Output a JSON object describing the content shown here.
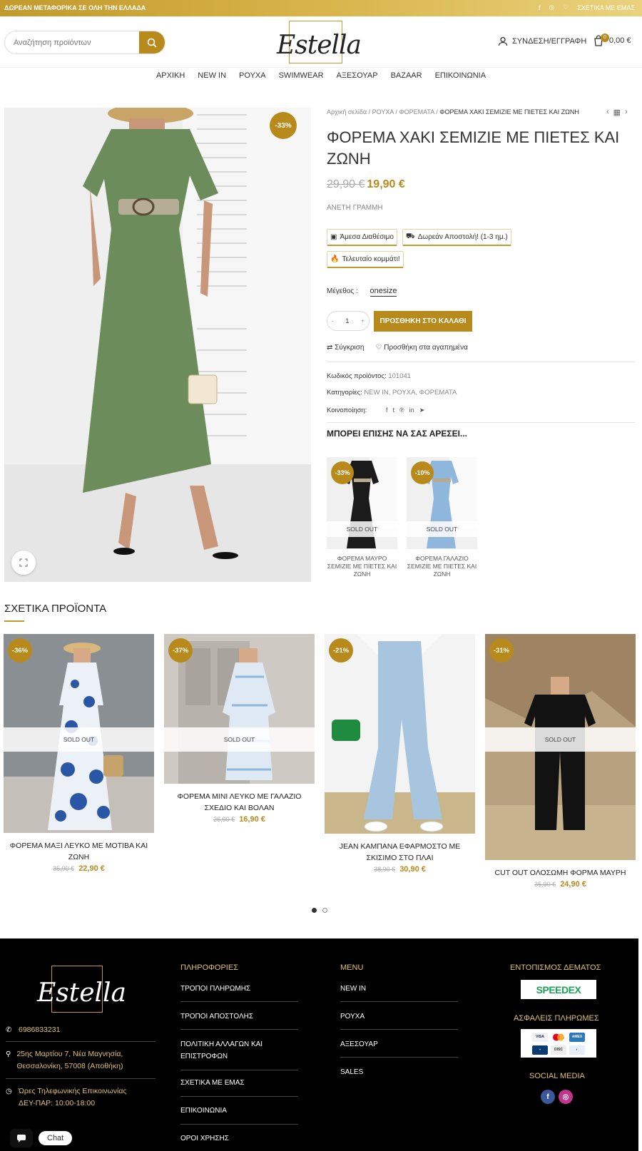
{
  "topbar": {
    "promo": "ΔΩΡΕΑΝ ΜΕΤΑΦΟΡΙΚΑ ΣΕ ΟΛΗ ΤΗΝ ΕΛΛΑΔΑ",
    "about": "ΣΧΕΤΙΚΑ ΜΕ ΕΜΑΣ"
  },
  "header": {
    "search_placeholder": "Αναζήτηση προϊόντων",
    "logo": "Estella",
    "account": "ΣΥΝΔΕΣΗ/ΕΓΓΡΑΦΗ",
    "cart_count": "0",
    "cart_total": "0,00 €"
  },
  "nav": [
    "ΑΡΧΙΚΗ",
    "NEW IN",
    "ΡΟΥΧΑ",
    "SWIMWEAR",
    "ΑΞΕΣΟΥΑΡ",
    "BAZAAR",
    "ΕΠΙΚΟΙΝΩΝΙΑ"
  ],
  "product": {
    "discount": "-33%",
    "breadcrumb": [
      "Αρχική σελίδα",
      "ΡΟΥΧΑ",
      "ΦΟΡΕΜΑΤΑ",
      "ΦΟΡΕΜΑ ΧΑΚΙ ΣΕΜΙΖΙΕ ΜΕ ΠΙΕΤΕΣ ΚΑΙ ΖΩΝΗ"
    ],
    "title": "ΦΟΡΕΜΑ ΧΑΚΙ ΣΕΜΙΖΙΕ ΜΕ ΠΙΕΤΕΣ ΚΑΙ ΖΩΝΗ",
    "old_price": "29,90 €",
    "price": "19,90 €",
    "line": "ΑΝΕΤΗ ΓΡΑΜΜΗ",
    "tags": [
      "Άμεσα Διαθέσιμο",
      "Δωρεάν Αποστολή! (1-3 ημ.)",
      "Τελευταίο κομμάτι!"
    ],
    "size_label": "Μέγεθος :",
    "size_value": "onesize",
    "qty": "1",
    "add_to_cart": "ΠΡΟΣΘΗΚΗ ΣΤΟ ΚΑΛΑΘΙ",
    "compare": "Σύγκριση",
    "wishlist": "Προσθήκη στα αγαπημένα",
    "sku_label": "Κωδικός προϊόντος:",
    "sku": "101041",
    "cat_label": "Κατηγορίες:",
    "cats": "NEW IN, ΡΟΥΧΑ, ΦΟΡΕΜΑΤΑ",
    "share_label": "Κοινοποίηση:"
  },
  "upsell": {
    "title": "ΜΠΟΡΕΙ ΕΠΙΣΗΣ ΝΑ ΣΑΣ ΑΡΕΣΕΙ...",
    "items": [
      {
        "badge": "-33%",
        "status": "SOLD OUT",
        "name": "ΦΟΡΕΜΑ ΜΑΥΡΟ ΣΕΜΙΖΙΕ ΜΕ ΠΙΕΤΕΣ ΚΑΙ ΖΩΝΗ"
      },
      {
        "badge": "-10%",
        "status": "SOLD OUT",
        "name": "ΦΟΡΕΜΑ ΓΑΛΑΖΙΟ ΣΕΜΙΖΙΕ ΜΕ ΠΙΕΤΕΣ ΚΑΙ ΖΩΝΗ"
      }
    ]
  },
  "related": {
    "title": "ΣΧΕΤΙΚΑ ΠΡΟΪΟΝΤΑ",
    "items": [
      {
        "badge": "-36%",
        "status": "SOLD OUT",
        "name": "ΦΟΡΕΜΑ ΜΑΞΙ ΛΕΥΚΟ ΜΕ ΜΟΤΙΒΑ ΚΑΙ ΖΩΝΗ",
        "old": "35,90 €",
        "price": "22,90 €"
      },
      {
        "badge": "-37%",
        "status": "SOLD OUT",
        "name": "ΦΟΡΕΜΑ ΜΙΝΙ ΛΕΥΚΟ ΜΕ ΓΑΛΑΖΙΟ ΣΧΕΔΙΟ ΚΑΙ ΒΟΛΑΝ",
        "old": "26,90 €",
        "price": "16,90 €"
      },
      {
        "badge": "-21%",
        "status": "",
        "name": "JEAN ΚΑΜΠΑΝΑ ΕΦΑΡΜΟΣΤΟ ΜΕ ΣΚΙΣΙΜΟ ΣΤΟ ΠΛΑΙ",
        "old": "38,90 €",
        "price": "30,90 €"
      },
      {
        "badge": "-31%",
        "status": "SOLD OUT",
        "name": "CUT OUT ΟΛΟΣΩΜΗ ΦΟΡΜΑ ΜΑΥΡΗ",
        "old": "35,90 €",
        "price": "24,90 €"
      }
    ]
  },
  "footer": {
    "logo": "Estella",
    "phone": "6986833231",
    "address": "25ης Μαρτίου 7, Νέα Μαγνησία, Θεσσαλονίκη, 57008 (Αποθήκη)",
    "hours_label": "Ώρες Τηλεφωνικής Επικοινωνίας",
    "hours": "ΔΕΥ-ΠΑΡ: 10:00-18:00",
    "info_title": "ΠΛΗΡΟΦΟΡΙΕΣ",
    "info_links": [
      "ΤΡΟΠΟΙ ΠΛΗΡΩΜΗΣ",
      "ΤΡΟΠΟΙ ΑΠΟΣΤΟΛΗΣ",
      "ΠΟΛΙΤΙΚΗ ΑΛΛΑΓΩΝ ΚΑΙ ΕΠΙΣΤΡΟΦΩΝ",
      "ΣΧΕΤΙΚΑ ΜΕ ΕΜΑΣ",
      "ΕΠΙΚΟΙΝΩΝΙΑ",
      "ΟΡΟΙ ΧΡΗΣΗΣ"
    ],
    "menu_title": "MENU",
    "menu_links": [
      "NEW IN",
      "ΡΟΥΧΑ",
      "ΑΞΕΣΟΥΑΡ",
      "SALES"
    ],
    "tracking_title": "ΕΝΤΟΠΙΣΜΟΣ ΔΕΜΑΤΟΣ",
    "speedex": "SPEEDEX",
    "payments_title": "ΑΣΦΑΛΕΙΣ ΠΛΗΡΩΜΕΣ",
    "social_title": "SOCIAL MEDIA"
  },
  "chat": {
    "label": "Chat"
  }
}
